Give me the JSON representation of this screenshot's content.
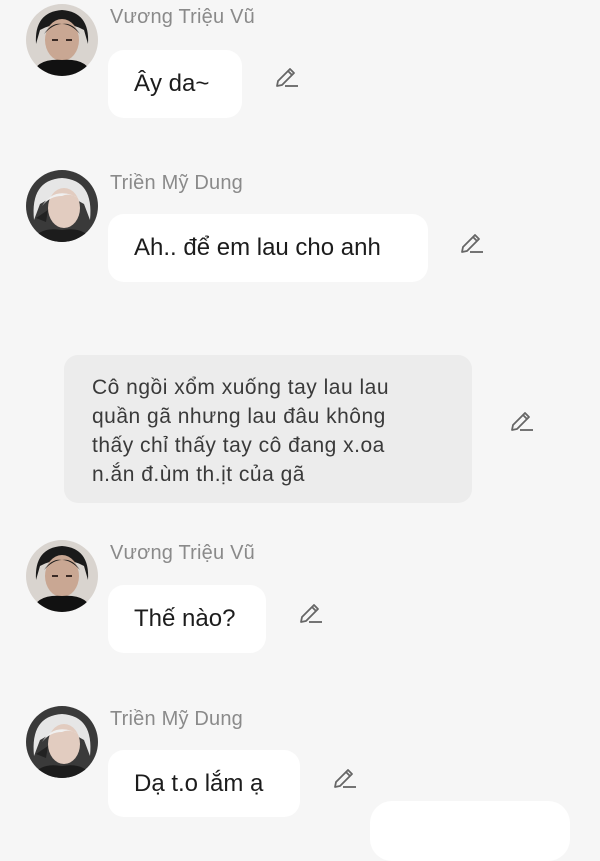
{
  "messages": [
    {
      "sender": "Vương Triệu Vũ",
      "text": "Ây da~",
      "avatar": "dark-haired-man-avatar"
    },
    {
      "sender": "Triền Mỹ Dung",
      "text": "Ah.. để em lau cho anh",
      "avatar": "white-haired-woman-avatar"
    },
    {
      "sender": "Vương Triệu Vũ",
      "text": "Thế nào?",
      "avatar": "dark-haired-man-avatar"
    },
    {
      "sender": "Triền Mỹ Dung",
      "text": "Dạ t.o lắm ạ",
      "avatar": "white-haired-woman-avatar"
    }
  ],
  "narration": {
    "lines": [
      "Cô ngồi xổm xuống tay lau lau",
      "quần gã nhưng lau đâu không",
      "thấy chỉ thấy tay cô đang x.oa",
      "n.ắn đ.ùm th.ịt của gã"
    ]
  },
  "icons": {
    "edit": "pencil-edit-icon"
  },
  "colors": {
    "background": "#f6f6f6",
    "bubble": "#ffffff",
    "narration_bubble": "#ececec",
    "sender_name": "#8a8a8a",
    "text": "#1c1c1c"
  }
}
